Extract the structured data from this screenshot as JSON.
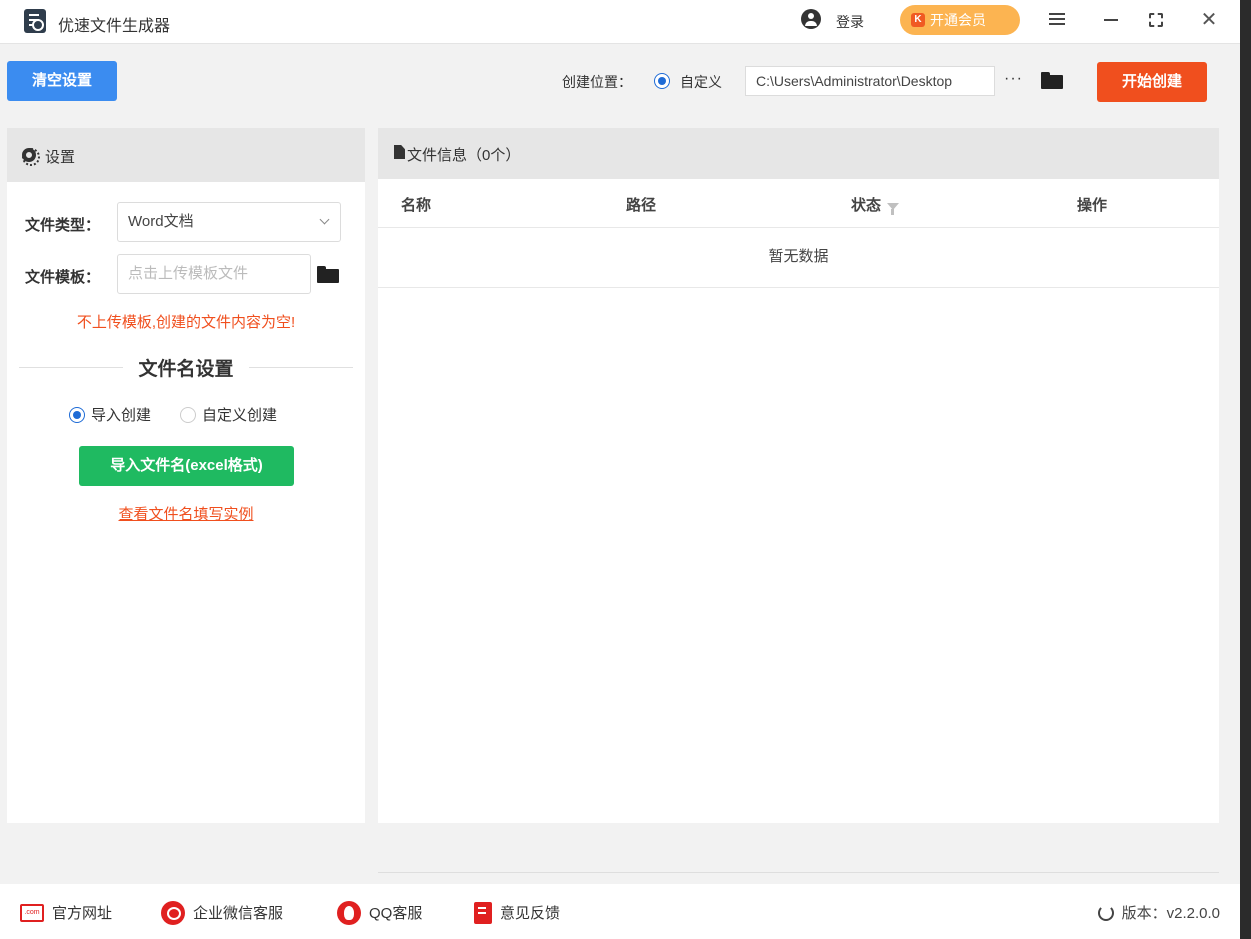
{
  "titlebar": {
    "app_title": "优速文件生成器",
    "login": "登录",
    "vip_badge": "K",
    "vip": "开通会员",
    "icons": [
      "app-logo-icon",
      "user-icon",
      "vip-icon",
      "menu-icon",
      "minimize-icon",
      "maximize-icon",
      "close-icon"
    ]
  },
  "toolbar": {
    "clear_label": "清空设置",
    "location_label": "创建位置：",
    "location_option": "自定义",
    "path_value": "C:\\Users\\Administrator\\Desktop",
    "more": "···",
    "start_label": "开始创建"
  },
  "settings": {
    "header": "设置",
    "file_type_label": "文件类型：",
    "file_type_value": "Word文档",
    "template_label": "文件模板：",
    "template_placeholder": "点击上传模板文件",
    "warning": "不上传模板,创建的文件内容为空!",
    "section_title": "文件名设置",
    "radio_import": "导入创建",
    "radio_custom": "自定义创建",
    "import_button": "导入文件名(excel格式)",
    "example_link": "查看文件名填写实例"
  },
  "file_info": {
    "header": "文件信息（0个）",
    "columns": [
      "名称",
      "路径",
      "状态",
      "操作"
    ],
    "empty_text": "暂无数据"
  },
  "footer": {
    "website": "官方网址",
    "web_badge": ".com",
    "wechat": "企业微信客服",
    "qq": "QQ客服",
    "feedback": "意见反馈",
    "version": "版本：v2.2.0.0"
  },
  "colors": {
    "primary_blue": "#3b8cf0",
    "start_red": "#f04f1e",
    "import_green": "#1fba61",
    "vip_orange": "#fcb451",
    "warning_red": "#f04f1e",
    "footer_icon_red": "#e02020"
  }
}
